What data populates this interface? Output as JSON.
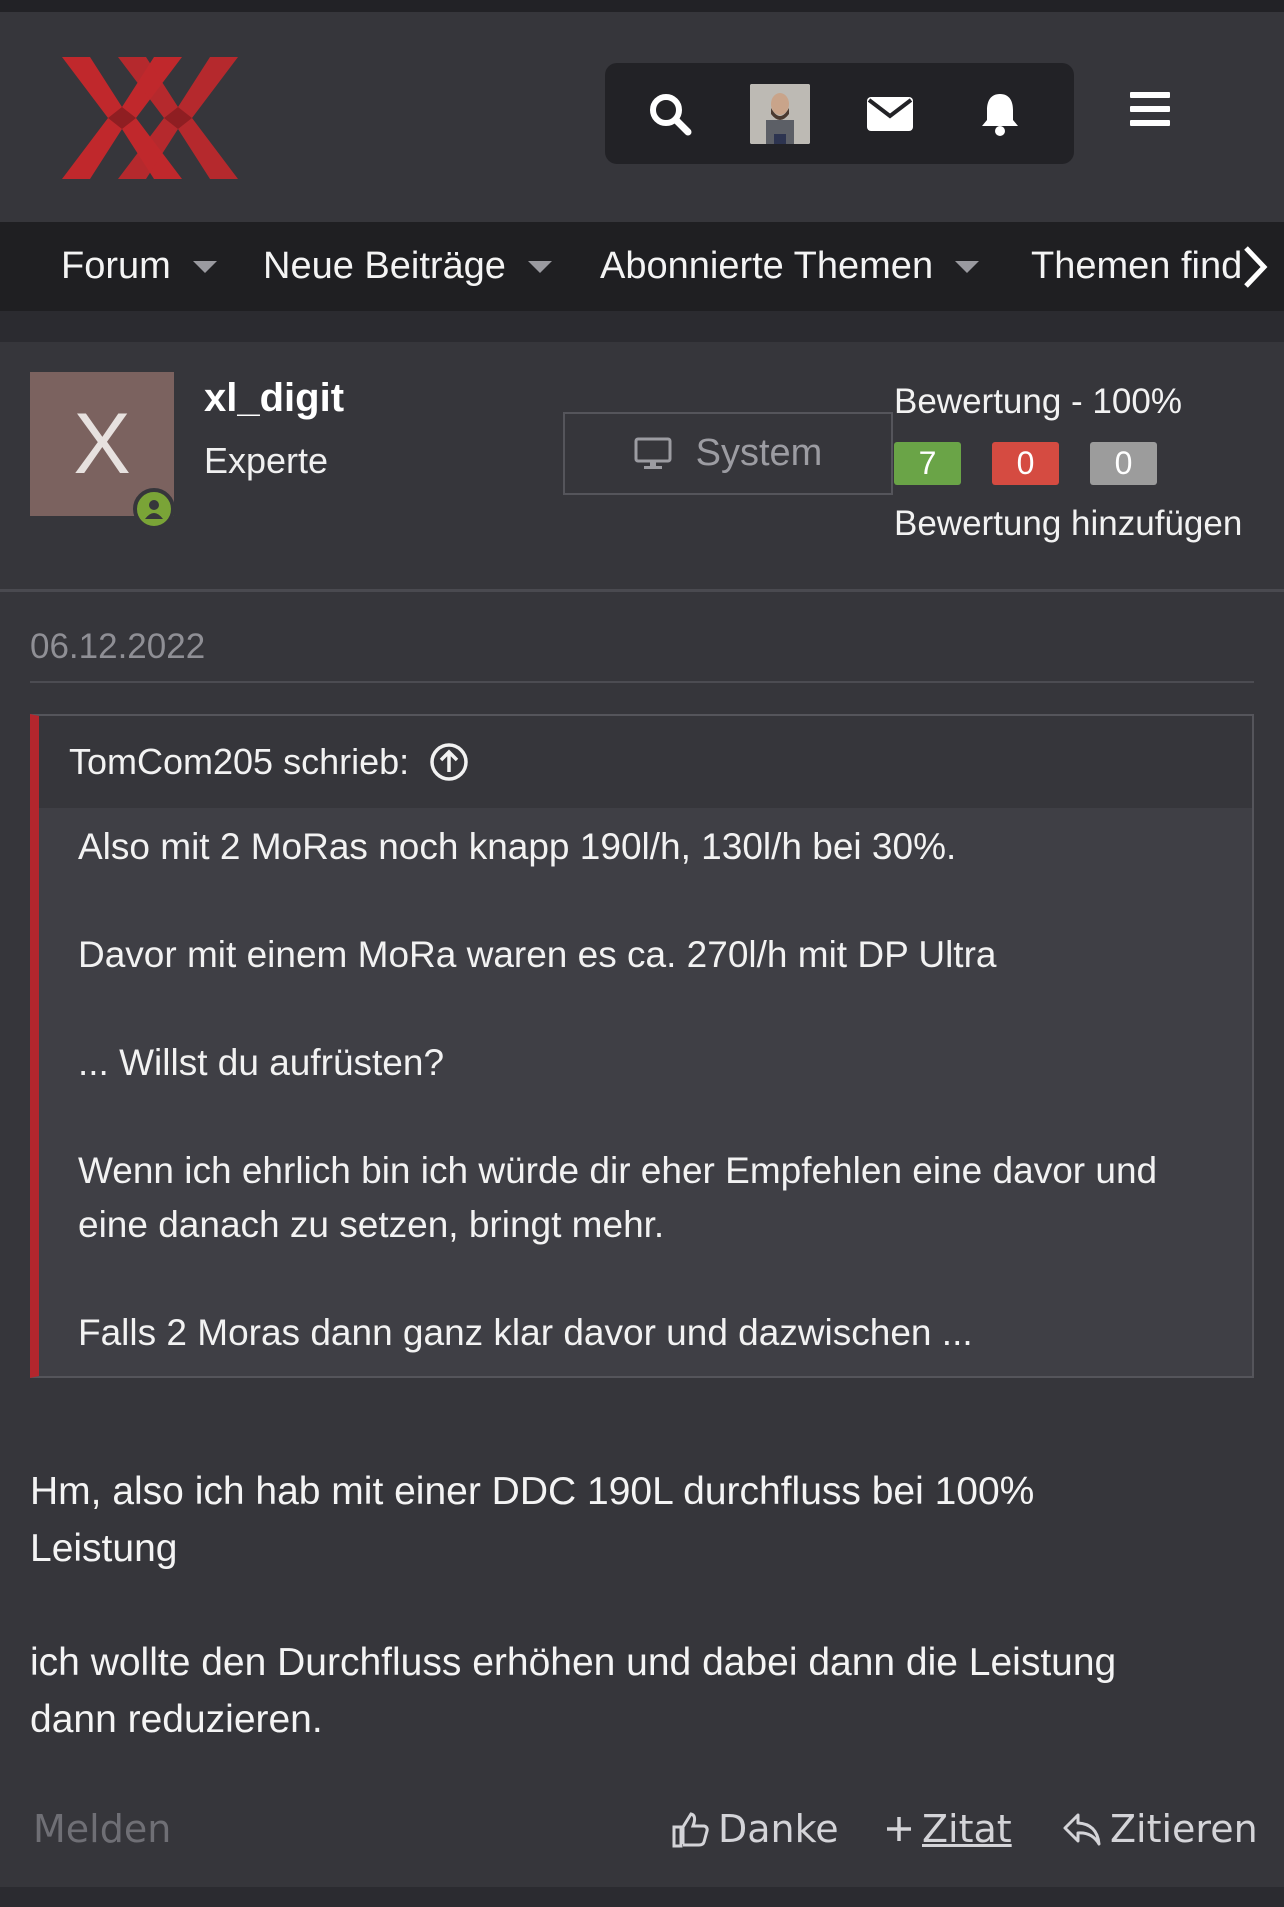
{
  "header": {
    "logo_icon": "xx-logo-icon",
    "icons": [
      "search-icon",
      "user-avatar",
      "envelope-icon",
      "bell-icon",
      "hamburger-menu-icon"
    ]
  },
  "nav": {
    "items": [
      {
        "label": "Forum"
      },
      {
        "label": "Neue Beiträge"
      },
      {
        "label": "Abonnierte Themen"
      },
      {
        "label": "Themen find"
      }
    ],
    "next_icon": "chevron-right-icon"
  },
  "author": {
    "avatar_letter": "X",
    "name": "xl_digit",
    "rank": "Experte",
    "system_label": "System",
    "rating_title": "Bewertung - 100%",
    "rating_positive": "7",
    "rating_negative": "0",
    "rating_neutral": "0",
    "rating_add": "Bewertung hinzufügen",
    "colors": {
      "positive": "#6aa447",
      "negative": "#d54b41",
      "neutral": "#9c9c9c",
      "avatar_bg": "#7b625f"
    }
  },
  "post": {
    "date": "06.12.2022",
    "quote": {
      "author_label": "TomCom205 schrieb:",
      "lines": [
        "Also mit 2 MoRas noch knapp 190l/h, 130l/h bei 30%.",
        "Davor mit einem MoRa waren es ca. 270l/h mit DP Ultra",
        "... Willst du aufrüsten?",
        "Wenn ich ehrlich bin ich würde dir eher Empfehlen eine davor und",
        "eine danach zu setzen, bringt mehr.",
        "Falls 2 Moras dann ganz klar davor und dazwischen ..."
      ]
    },
    "body_lines": [
      "Hm, also ich hab mit einer DDC 190L durchfluss bei 100%",
      "Leistung",
      "ich wollte den Durchfluss erhöhen und dabei dann die Leistung",
      "dann reduzieren."
    ],
    "actions": {
      "report": "Melden",
      "thanks": "Danke",
      "add_quote": "Zitat",
      "reply_quote": "Zitieren"
    },
    "accent_color": "#b3262d"
  }
}
